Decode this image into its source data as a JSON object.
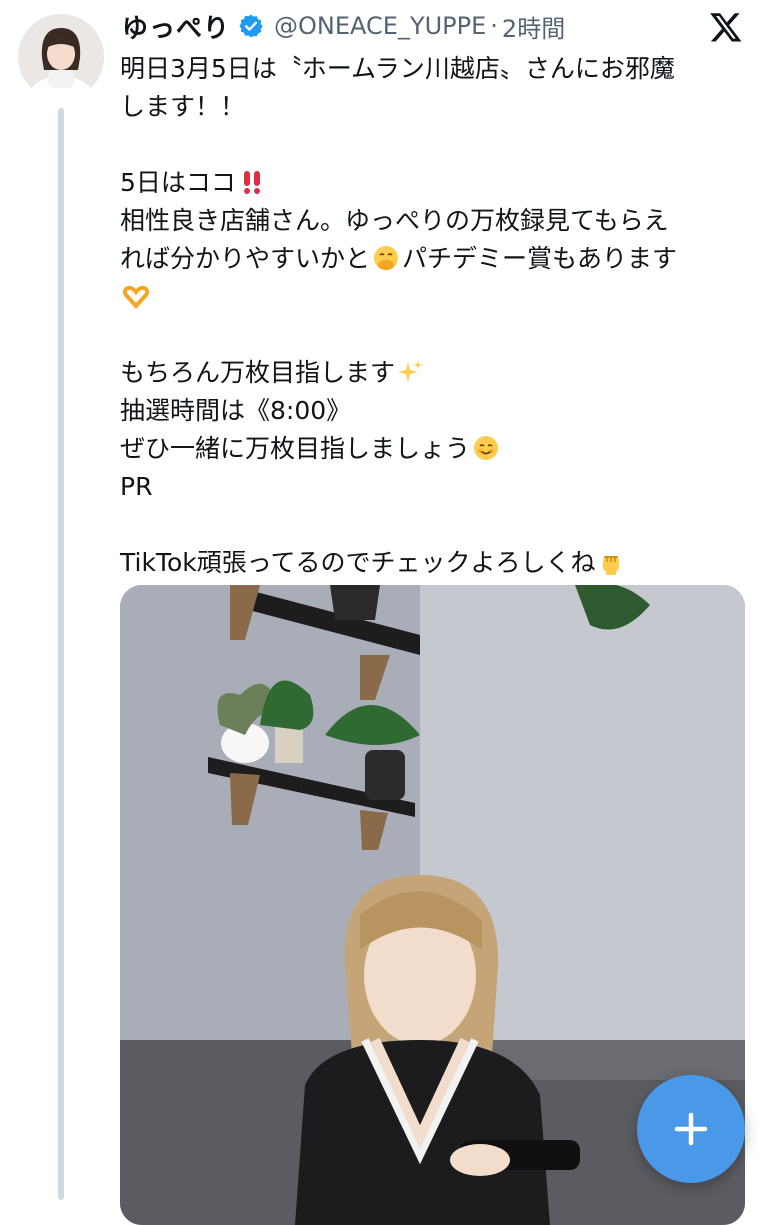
{
  "tweet": {
    "author_name": "ゆっぺり",
    "handle": "@ONEACE_YUPPE",
    "separator": "·",
    "time": "2時間",
    "lines": [
      "明日3月5日は〝ホームラン川越店〟さんにお邪魔",
      "します！！",
      "",
      "5日はココ",
      "相性良き店舗さん。ゆっぺりの万枚録見てもらえ",
      "れば分かりやすいかと",
      "",
      "",
      "もちろん万枚目指します",
      "抽選時間は《8:00》",
      "ぜひ一緒に万枚目指しましょう",
      "PR",
      "",
      "TikTok頑張ってるのでチェックよろしくね"
    ],
    "line6_suffix": "パチデミー賞もあります"
  },
  "icons": {
    "verified": "verified-badge-icon",
    "x_logo": "x-logo-icon",
    "compose": "plus-icon",
    "emoji_double_exclamation": "double-exclamation-icon",
    "emoji_hand_over_mouth": "face-hand-over-mouth-icon",
    "emoji_heart_hands": "heart-hands-icon",
    "emoji_sparkles": "sparkles-icon",
    "emoji_smiling": "smiling-face-icon",
    "emoji_fist": "raised-fist-icon"
  },
  "colors": {
    "accent": "#1d9bf0",
    "fab": "#4a99e9",
    "secondary_text": "#536471",
    "thread_line": "#cfd9de"
  }
}
